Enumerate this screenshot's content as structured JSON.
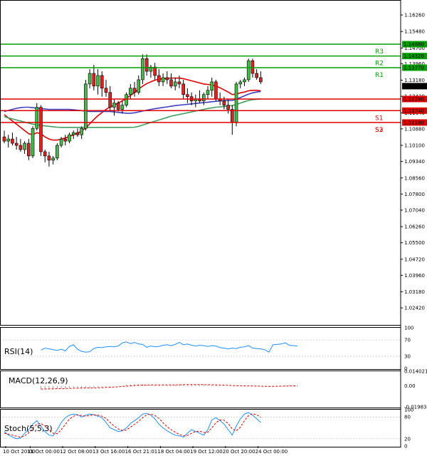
{
  "chart_data": {
    "type": "candlestick",
    "main": {
      "ylim": [
        1.0165,
        1.168
      ],
      "price_ticks": [
        "1.16260",
        "1.15480",
        "1.14700",
        "1.13960",
        "1.13180",
        "1.12420",
        "1.11640",
        "1.10880",
        "1.10100",
        "1.09340",
        "1.08560",
        "1.07800",
        "1.07040",
        "1.06260",
        "1.05500",
        "1.04720",
        "1.03960",
        "1.03180",
        "1.02420"
      ],
      "levels": [
        {
          "name": "R3",
          "value": 1.1488,
          "label": "1.14880",
          "color": "#00a000"
        },
        {
          "name": "R2",
          "value": 1.1432,
          "label": "1.14320",
          "color": "#00a000"
        },
        {
          "name": "R1",
          "value": 1.1377,
          "label": "1.13770",
          "color": "#00a000"
        },
        {
          "name": "",
          "value": 1.1229,
          "label": "1.12290",
          "color": "#e00000"
        },
        {
          "name": "S1",
          "value": 1.1174,
          "label": "1.11740",
          "color": "#e00000"
        },
        {
          "name": "S2",
          "value": 1.1118,
          "label": "1.11180",
          "color": "#e00000"
        }
      ],
      "bottom_labels": [
        "S3"
      ],
      "current_price": "1.12898",
      "candles": [
        {
          "o": 1.105,
          "h": 1.108,
          "l": 1.102,
          "c": 1.103
        },
        {
          "o": 1.103,
          "h": 1.106,
          "l": 1.1,
          "c": 1.104
        },
        {
          "o": 1.104,
          "h": 1.107,
          "l": 1.101,
          "c": 1.102
        },
        {
          "o": 1.102,
          "h": 1.105,
          "l": 1.099,
          "c": 1.101
        },
        {
          "o": 1.101,
          "h": 1.104,
          "l": 1.098,
          "c": 1.099
        },
        {
          "o": 1.099,
          "h": 1.103,
          "l": 1.097,
          "c": 1.102
        },
        {
          "o": 1.102,
          "h": 1.104,
          "l": 1.094,
          "c": 1.096
        },
        {
          "o": 1.096,
          "h": 1.11,
          "l": 1.095,
          "c": 1.109
        },
        {
          "o": 1.109,
          "h": 1.121,
          "l": 1.108,
          "c": 1.119
        },
        {
          "o": 1.119,
          "h": 1.12,
          "l": 1.096,
          "c": 1.098
        },
        {
          "o": 1.098,
          "h": 1.099,
          "l": 1.093,
          "c": 1.096
        },
        {
          "o": 1.096,
          "h": 1.098,
          "l": 1.091,
          "c": 1.094
        },
        {
          "o": 1.094,
          "h": 1.096,
          "l": 1.092,
          "c": 1.095
        },
        {
          "o": 1.095,
          "h": 1.102,
          "l": 1.094,
          "c": 1.101
        },
        {
          "o": 1.101,
          "h": 1.105,
          "l": 1.1,
          "c": 1.104
        },
        {
          "o": 1.104,
          "h": 1.106,
          "l": 1.101,
          "c": 1.103
        },
        {
          "o": 1.103,
          "h": 1.107,
          "l": 1.102,
          "c": 1.106
        },
        {
          "o": 1.106,
          "h": 1.108,
          "l": 1.104,
          "c": 1.107
        },
        {
          "o": 1.107,
          "h": 1.109,
          "l": 1.105,
          "c": 1.106
        },
        {
          "o": 1.106,
          "h": 1.11,
          "l": 1.104,
          "c": 1.109
        },
        {
          "o": 1.109,
          "h": 1.132,
          "l": 1.108,
          "c": 1.13
        },
        {
          "o": 1.13,
          "h": 1.137,
          "l": 1.128,
          "c": 1.135
        },
        {
          "o": 1.135,
          "h": 1.139,
          "l": 1.127,
          "c": 1.129
        },
        {
          "o": 1.129,
          "h": 1.137,
          "l": 1.125,
          "c": 1.134
        },
        {
          "o": 1.134,
          "h": 1.136,
          "l": 1.124,
          "c": 1.128
        },
        {
          "o": 1.128,
          "h": 1.132,
          "l": 1.124,
          "c": 1.126
        },
        {
          "o": 1.126,
          "h": 1.129,
          "l": 1.117,
          "c": 1.119
        },
        {
          "o": 1.119,
          "h": 1.123,
          "l": 1.115,
          "c": 1.121
        },
        {
          "o": 1.121,
          "h": 1.122,
          "l": 1.117,
          "c": 1.118
        },
        {
          "o": 1.118,
          "h": 1.122,
          "l": 1.116,
          "c": 1.12
        },
        {
          "o": 1.12,
          "h": 1.126,
          "l": 1.119,
          "c": 1.125
        },
        {
          "o": 1.125,
          "h": 1.13,
          "l": 1.123,
          "c": 1.128
        },
        {
          "o": 1.128,
          "h": 1.131,
          "l": 1.124,
          "c": 1.126
        },
        {
          "o": 1.126,
          "h": 1.134,
          "l": 1.125,
          "c": 1.132
        },
        {
          "o": 1.132,
          "h": 1.144,
          "l": 1.13,
          "c": 1.142
        },
        {
          "o": 1.142,
          "h": 1.144,
          "l": 1.134,
          "c": 1.136
        },
        {
          "o": 1.136,
          "h": 1.139,
          "l": 1.133,
          "c": 1.138
        },
        {
          "o": 1.138,
          "h": 1.14,
          "l": 1.132,
          "c": 1.134
        },
        {
          "o": 1.134,
          "h": 1.137,
          "l": 1.129,
          "c": 1.131
        },
        {
          "o": 1.131,
          "h": 1.135,
          "l": 1.129,
          "c": 1.133
        },
        {
          "o": 1.133,
          "h": 1.136,
          "l": 1.13,
          "c": 1.132
        },
        {
          "o": 1.132,
          "h": 1.135,
          "l": 1.128,
          "c": 1.129
        },
        {
          "o": 1.129,
          "h": 1.133,
          "l": 1.127,
          "c": 1.131
        },
        {
          "o": 1.131,
          "h": 1.134,
          "l": 1.128,
          "c": 1.13
        },
        {
          "o": 1.13,
          "h": 1.132,
          "l": 1.123,
          "c": 1.125
        },
        {
          "o": 1.125,
          "h": 1.128,
          "l": 1.121,
          "c": 1.124
        },
        {
          "o": 1.124,
          "h": 1.126,
          "l": 1.12,
          "c": 1.122
        },
        {
          "o": 1.122,
          "h": 1.125,
          "l": 1.119,
          "c": 1.123
        },
        {
          "o": 1.123,
          "h": 1.127,
          "l": 1.121,
          "c": 1.122
        },
        {
          "o": 1.122,
          "h": 1.126,
          "l": 1.12,
          "c": 1.125
        },
        {
          "o": 1.125,
          "h": 1.129,
          "l": 1.123,
          "c": 1.127
        },
        {
          "o": 1.127,
          "h": 1.133,
          "l": 1.124,
          "c": 1.131
        },
        {
          "o": 1.131,
          "h": 1.132,
          "l": 1.122,
          "c": 1.123
        },
        {
          "o": 1.123,
          "h": 1.126,
          "l": 1.12,
          "c": 1.122
        },
        {
          "o": 1.122,
          "h": 1.124,
          "l": 1.118,
          "c": 1.12
        },
        {
          "o": 1.12,
          "h": 1.123,
          "l": 1.116,
          "c": 1.118
        },
        {
          "o": 1.118,
          "h": 1.12,
          "l": 1.106,
          "c": 1.112
        },
        {
          "o": 1.112,
          "h": 1.131,
          "l": 1.11,
          "c": 1.13
        },
        {
          "o": 1.13,
          "h": 1.132,
          "l": 1.128,
          "c": 1.131
        },
        {
          "o": 1.131,
          "h": 1.133,
          "l": 1.129,
          "c": 1.132
        },
        {
          "o": 1.132,
          "h": 1.142,
          "l": 1.131,
          "c": 1.141
        },
        {
          "o": 1.141,
          "h": 1.142,
          "l": 1.133,
          "c": 1.135
        },
        {
          "o": 1.135,
          "h": 1.137,
          "l": 1.132,
          "c": 1.133
        },
        {
          "o": 1.133,
          "h": 1.136,
          "l": 1.13,
          "c": 1.131
        }
      ],
      "moving_averages": [
        {
          "color": "#e00000",
          "values": [
            1.1155,
            1.114,
            1.1125,
            1.111,
            1.1095,
            1.108,
            1.1065,
            1.106,
            1.107,
            1.1065,
            1.105,
            1.104,
            1.1035,
            1.1035,
            1.104,
            1.1045,
            1.1052,
            1.106,
            1.1068,
            1.1078,
            1.1092,
            1.1112,
            1.1132,
            1.115,
            1.1165,
            1.118,
            1.1192,
            1.12,
            1.121,
            1.122,
            1.1232,
            1.1246,
            1.126,
            1.1275,
            1.129,
            1.1302,
            1.131,
            1.1318,
            1.1322,
            1.1325,
            1.1327,
            1.1328,
            1.1328,
            1.1328,
            1.1325,
            1.132,
            1.1315,
            1.131,
            1.1305,
            1.13,
            1.1298,
            1.1296,
            1.129,
            1.1282,
            1.1272,
            1.1262,
            1.125,
            1.1252,
            1.1258,
            1.1262,
            1.1268,
            1.127,
            1.127,
            1.1268
          ]
        },
        {
          "color": "#4040c0",
          "values": [
            1.117,
            1.1175,
            1.118,
            1.1185,
            1.1188,
            1.119,
            1.119,
            1.1188,
            1.1185,
            1.1183,
            1.1182,
            1.118,
            1.118,
            1.118,
            1.118,
            1.118,
            1.118,
            1.1178,
            1.1176,
            1.1174,
            1.1172,
            1.117,
            1.117,
            1.117,
            1.117,
            1.117,
            1.117,
            1.1168,
            1.1166,
            1.1164,
            1.1162,
            1.1162,
            1.1164,
            1.1168,
            1.1172,
            1.1176,
            1.118,
            1.1183,
            1.1186,
            1.1189,
            1.1192,
            1.1195,
            1.1198,
            1.12,
            1.1202,
            1.1204,
            1.1206,
            1.1208,
            1.121,
            1.1212,
            1.1214,
            1.1216,
            1.1218,
            1.122,
            1.1221,
            1.1222,
            1.1222,
            1.1228,
            1.1236,
            1.1244,
            1.1252,
            1.1258,
            1.1262,
            1.1265
          ]
        },
        {
          "color": "#40a060",
          "values": [
            1.1145,
            1.114,
            1.1135,
            1.113,
            1.1125,
            1.112,
            1.1115,
            1.111,
            1.1107,
            1.1104,
            1.1102,
            1.11,
            1.1098,
            1.1096,
            1.1095,
            1.1095,
            1.1095,
            1.1095,
            1.1095,
            1.1095,
            1.1095,
            1.1095,
            1.1095,
            1.1095,
            1.1095,
            1.1095,
            1.1095,
            1.1095,
            1.1095,
            1.1095,
            1.1095,
            1.1095,
            1.1096,
            1.11,
            1.1106,
            1.1112,
            1.1118,
            1.1124,
            1.113,
            1.1136,
            1.1142,
            1.1148,
            1.1152,
            1.1156,
            1.116,
            1.1164,
            1.1168,
            1.1172,
            1.1176,
            1.118,
            1.1184,
            1.1187,
            1.119,
            1.1192,
            1.1194,
            1.1196,
            1.1198,
            1.1203,
            1.121,
            1.1216,
            1.1222,
            1.1226,
            1.1228,
            1.123
          ]
        }
      ]
    },
    "rsi": {
      "label": "RSI(14)",
      "ticks": [
        "100",
        "70",
        "30",
        "0"
      ],
      "ylim": [
        0,
        100
      ],
      "values": [
        45,
        50,
        48,
        46,
        44,
        47,
        43,
        54,
        58,
        47,
        42,
        40,
        41,
        49,
        52,
        51,
        53,
        54,
        53,
        55,
        63,
        65,
        61,
        64,
        60,
        59,
        52,
        55,
        53,
        54,
        57,
        58,
        56,
        59,
        64,
        58,
        60,
        57,
        55,
        57,
        56,
        54,
        56,
        55,
        51,
        50,
        48,
        50,
        49,
        52,
        53,
        56,
        50,
        49,
        48,
        46,
        40,
        58,
        59,
        60,
        63,
        57,
        56,
        55
      ]
    },
    "macd": {
      "label": "MACD(12,26,9)",
      "ticks": [
        "0.014021",
        "0.00",
        "-0.019835"
      ],
      "ylim": [
        -0.019835,
        0.014021
      ],
      "histogram": [
        -0.0025,
        -0.0025,
        -0.0024,
        -0.0023,
        -0.0022,
        -0.0021,
        -0.0022,
        -0.0018,
        -0.0012,
        -0.0013,
        -0.0016,
        -0.0018,
        -0.0019,
        -0.0016,
        -0.0013,
        -0.0011,
        -0.0008,
        -0.0006,
        -0.0005,
        -0.0003,
        0.0005,
        0.0012,
        0.0014,
        0.0017,
        0.0017,
        0.0016,
        0.0012,
        0.0011,
        0.0009,
        0.0008,
        0.0009,
        0.001,
        0.001,
        0.0012,
        0.0016,
        0.0016,
        0.0016,
        0.0015,
        0.0013,
        0.0012,
        0.0011,
        0.0009,
        0.0008,
        0.0007,
        0.0004,
        0.0002,
        0.0,
        -0.0001,
        -0.0002,
        -0.0002,
        -0.0001,
        0.0001,
        -0.0001,
        -0.0002,
        -0.0003,
        -0.0005,
        -0.0009,
        -0.0002,
        0.0002,
        0.0005,
        0.0009,
        0.0009,
        0.0009,
        0.0008
      ],
      "signal": [
        -0.003,
        -0.0029,
        -0.0028,
        -0.0027,
        -0.0026,
        -0.0025,
        -0.0024,
        -0.0023,
        -0.0021,
        -0.002,
        -0.0019,
        -0.0019,
        -0.0019,
        -0.0018,
        -0.0017,
        -0.0016,
        -0.0014,
        -0.0012,
        -0.001,
        -0.0008,
        -0.0005,
        -0.0002,
        0.0001,
        0.0004,
        0.0006,
        0.0008,
        0.0009,
        0.001,
        0.001,
        0.001,
        0.001,
        0.001,
        0.001,
        0.001,
        0.0011,
        0.0012,
        0.0013,
        0.0013,
        0.0013,
        0.0013,
        0.0013,
        0.0012,
        0.0011,
        0.001,
        0.0009,
        0.0008,
        0.0006,
        0.0004,
        0.0003,
        0.0002,
        0.0001,
        0.0001,
        0.0,
        -0.0001,
        -0.0002,
        -0.0003,
        -0.0004,
        -0.0004,
        -0.0003,
        -0.0002,
        -0.0001,
        0.0,
        0.0001,
        0.0002
      ]
    },
    "stoch": {
      "label": "Stoch(5,5,3)",
      "ticks": [
        "100",
        "80",
        "20",
        "0"
      ],
      "ylim": [
        0,
        100
      ],
      "main": [
        40,
        30,
        25,
        20,
        22,
        35,
        45,
        60,
        70,
        55,
        40,
        30,
        28,
        45,
        65,
        78,
        85,
        88,
        86,
        80,
        85,
        88,
        86,
        82,
        78,
        65,
        50,
        45,
        40,
        42,
        50,
        62,
        70,
        78,
        88,
        90,
        85,
        75,
        60,
        50,
        42,
        35,
        30,
        28,
        25,
        35,
        45,
        40,
        35,
        30,
        45,
        72,
        78,
        70,
        60,
        45,
        30,
        55,
        75,
        88,
        92,
        85,
        75,
        65
      ],
      "signal": [
        35,
        33,
        30,
        27,
        24,
        28,
        36,
        48,
        60,
        62,
        55,
        45,
        35,
        34,
        45,
        60,
        74,
        82,
        86,
        84,
        82,
        84,
        86,
        85,
        82,
        76,
        65,
        55,
        47,
        43,
        44,
        52,
        60,
        68,
        78,
        86,
        88,
        84,
        76,
        64,
        53,
        45,
        38,
        32,
        28,
        29,
        35,
        40,
        41,
        37,
        38,
        50,
        64,
        72,
        71,
        62,
        47,
        42,
        52,
        70,
        84,
        89,
        86,
        79
      ]
    },
    "x_labels": [
      "10 Oct 20:00",
      "11 Oct 00:00",
      "12 Oct 08:00",
      "13 Oct 16:00",
      "16 Oct 21:01",
      "18 Oct 04:00",
      "19 Oct 12:00",
      "20 Oct 20:00",
      "24 Oct 00:00"
    ]
  }
}
